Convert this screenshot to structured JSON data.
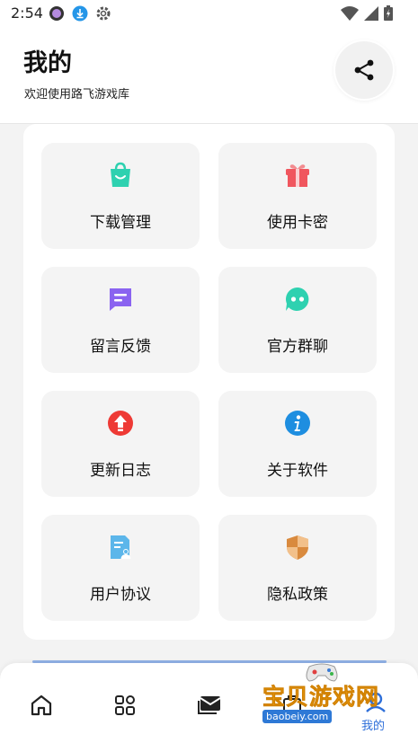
{
  "status_bar": {
    "time": "2:54"
  },
  "header": {
    "title": "我的",
    "subtitle": "欢迎使用路飞游戏库"
  },
  "menu": {
    "items": [
      {
        "label": "下载管理",
        "icon": "shopping-bag-icon",
        "color": "#2ed1b0"
      },
      {
        "label": "使用卡密",
        "icon": "gift-icon",
        "color": "#f0565e"
      },
      {
        "label": "留言反馈",
        "icon": "message-square-icon",
        "color": "#8a63f0"
      },
      {
        "label": "官方群聊",
        "icon": "chat-bubble-icon",
        "color": "#2ed1b0"
      },
      {
        "label": "更新日志",
        "icon": "arrow-up-circle-icon",
        "color": "#ee3a35"
      },
      {
        "label": "关于软件",
        "icon": "info-icon",
        "color": "#1e8ee0"
      },
      {
        "label": "用户协议",
        "icon": "document-user-icon",
        "color": "#5cb6ea"
      },
      {
        "label": "隐私政策",
        "icon": "shield-icon",
        "color": "#d98a3e"
      }
    ]
  },
  "bottom_nav": {
    "active_label": "我的",
    "accent": "#2e6fd9"
  },
  "watermark": {
    "text": "宝贝游戏网",
    "url": "baobeiy.com"
  }
}
